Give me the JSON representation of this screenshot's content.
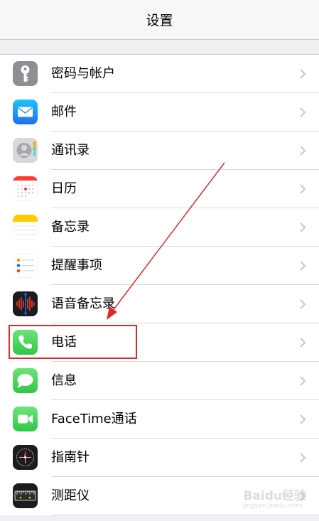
{
  "header": {
    "title": "设置"
  },
  "settings": {
    "items": [
      {
        "label": "密码与帐户",
        "icon": "key-icon"
      },
      {
        "label": "邮件",
        "icon": "mail-icon"
      },
      {
        "label": "通讯录",
        "icon": "contacts-icon"
      },
      {
        "label": "日历",
        "icon": "calendar-icon"
      },
      {
        "label": "备忘录",
        "icon": "notes-icon"
      },
      {
        "label": "提醒事项",
        "icon": "reminders-icon"
      },
      {
        "label": "语音备忘录",
        "icon": "voice-memos-icon"
      },
      {
        "label": "电话",
        "icon": "phone-icon"
      },
      {
        "label": "信息",
        "icon": "messages-icon"
      },
      {
        "label": "FaceTime通话",
        "icon": "facetime-icon"
      },
      {
        "label": "指南针",
        "icon": "compass-icon"
      },
      {
        "label": "测距仪",
        "icon": "measure-icon"
      }
    ]
  },
  "annotation": {
    "color": "#e3262a",
    "highlighted_item": "电话"
  },
  "watermark": {
    "text": "Baidu经验",
    "subtext": "jingyan.baidu.com"
  },
  "colors": {
    "background": "#efeff4",
    "mail": "#1a8cf5",
    "phone": "#4cd964",
    "facetime": "#4cd964",
    "key": "#8e8e93",
    "notes": "#ffcc00"
  }
}
